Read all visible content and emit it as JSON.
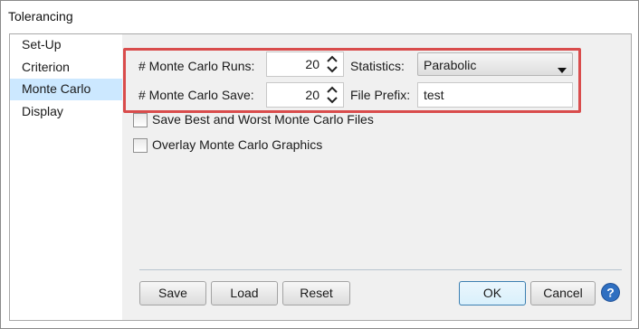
{
  "window": {
    "title": "Tolerancing"
  },
  "nav": {
    "items": [
      {
        "label": "Set-Up",
        "selected": false
      },
      {
        "label": "Criterion",
        "selected": false
      },
      {
        "label": "Monte Carlo",
        "selected": true
      },
      {
        "label": "Display",
        "selected": false
      }
    ]
  },
  "monte_carlo": {
    "runs_label": "# Monte Carlo Runs:",
    "runs_value": "20",
    "save_label": "# Monte Carlo Save:",
    "save_value": "20",
    "statistics_label": "Statistics:",
    "statistics_value": "Parabolic",
    "file_prefix_label": "File Prefix:",
    "file_prefix_value": "test",
    "save_best_worst_label": "Save Best and Worst Monte Carlo Files",
    "save_best_worst_checked": false,
    "overlay_label": "Overlay Monte Carlo Graphics",
    "overlay_checked": false
  },
  "buttons": {
    "save": "Save",
    "load": "Load",
    "reset": "Reset",
    "ok": "OK",
    "cancel": "Cancel"
  },
  "colors": {
    "highlight_border": "#d94c4c",
    "nav_selected": "#cce8ff",
    "help_icon": "#2f6fc1"
  }
}
